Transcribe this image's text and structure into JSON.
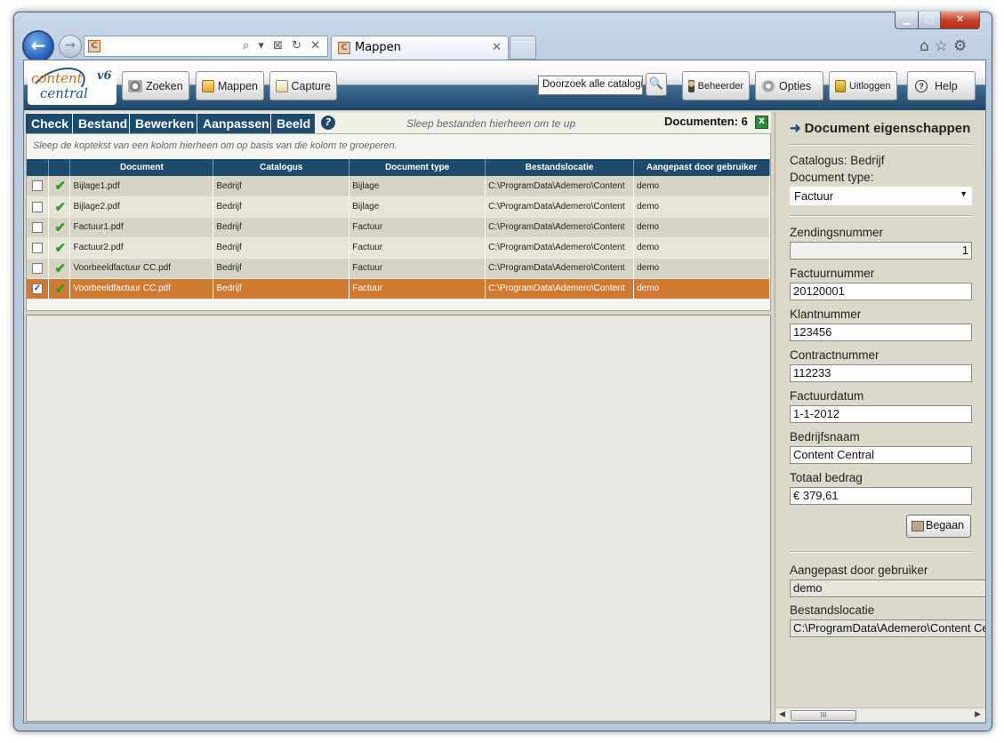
{
  "browser": {
    "tab_title": "Mappen",
    "address_value": "",
    "address_controls": "⌕ ▾ ⊠ ↻ ✕"
  },
  "app": {
    "logo_line1": "content",
    "logo_line2": "central",
    "logo_version": "v6",
    "toolbar": {
      "zoeken": "Zoeken",
      "mappen": "Mappen",
      "capture": "Capture",
      "search_value": "Doorzoek alle catalogi",
      "beheerder": "Beheerder",
      "opties": "Opties",
      "uitloggen": "Uitloggen",
      "help": "Help"
    },
    "menu": [
      "Check",
      "Bestand",
      "Bewerken",
      "Aanpassen",
      "Beeld"
    ],
    "drop_message": "Sleep bestanden hierheen om te up",
    "doc_count": "Documenten: 6",
    "group_hint": "Sleep de koptekst van een kolom hierheen om op basis van die kolom te groeperen.",
    "columns": [
      "Document",
      "Catalogus",
      "Document type",
      "Bestandslocatie",
      "Aangepast door gebruiker"
    ],
    "rows": [
      {
        "document": "Bijlage1.pdf",
        "catalogus": "Bedrijf",
        "type": "Bijlage",
        "locatie": "C:\\ProgramData\\Ademero\\Content",
        "user": "demo",
        "checked": false
      },
      {
        "document": "Bijlage2.pdf",
        "catalogus": "Bedrijf",
        "type": "Bijlage",
        "locatie": "C:\\ProgramData\\Ademero\\Content",
        "user": "demo",
        "checked": false
      },
      {
        "document": "Factuur1.pdf",
        "catalogus": "Bedrijf",
        "type": "Factuur",
        "locatie": "C:\\ProgramData\\Ademero\\Content",
        "user": "demo",
        "checked": false
      },
      {
        "document": "Factuur2.pdf",
        "catalogus": "Bedrijf",
        "type": "Factuur",
        "locatie": "C:\\ProgramData\\Ademero\\Content",
        "user": "demo",
        "checked": false
      },
      {
        "document": "Voorbeeldfactuur CC.pdf",
        "catalogus": "Bedrijf",
        "type": "Factuur",
        "locatie": "C:\\ProgramData\\Ademero\\Content",
        "user": "demo",
        "checked": false
      },
      {
        "document": "Voorbeeldfactuur CC.pdf",
        "catalogus": "Bedrijf",
        "type": "Factuur",
        "locatie": "C:\\ProgramData\\Ademero\\Content",
        "user": "demo",
        "checked": true
      }
    ]
  },
  "props": {
    "title": "Document eigenschappen",
    "catalogus": "Catalogus: Bedrijf",
    "doctype_label": "Document type:",
    "doctype_value": "Factuur",
    "fields": [
      {
        "label": "Zendingsnummer",
        "value": "1"
      },
      {
        "label": "Factuurnummer",
        "value": "20120001"
      },
      {
        "label": "Klantnummer",
        "value": "123456"
      },
      {
        "label": "Contractnummer",
        "value": "112233"
      },
      {
        "label": "Factuurdatum",
        "value": "1-1-2012"
      },
      {
        "label": "Bedrijfsnaam",
        "value": "Content Central"
      },
      {
        "label": "Totaal bedrag",
        "value": "€ 379,61"
      }
    ],
    "begaan": "Begaan",
    "modified_label": "Aangepast door gebruiker",
    "modified_value": "demo",
    "location_label": "Bestandslocatie",
    "location_value": "C:\\ProgramData\\Ademero\\Content Ce",
    "scroll_grip": "III"
  },
  "colors": {
    "selected_row": "#cf7a32",
    "header_blue": "#1e4a6b"
  }
}
